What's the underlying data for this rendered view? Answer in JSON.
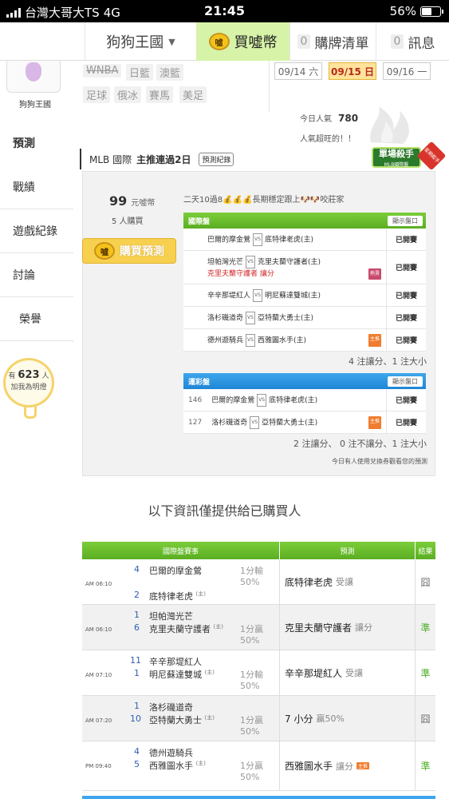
{
  "status_bar": {
    "carrier": "台灣大哥大TS",
    "network": "4G",
    "time": "21:45",
    "battery": "56%",
    "battery_level": 0.56
  },
  "nav": {
    "site_name": "狗狗王國",
    "buy_label": "買噓幣",
    "coin_glyph": "噓",
    "list_count": "0",
    "list_label": "購牌清單",
    "msg_count": "0",
    "msg_label": "訊息"
  },
  "profile": {
    "username": "狗狗王國"
  },
  "sidebar": {
    "items": [
      {
        "label": "預測"
      },
      {
        "label": "戰績"
      },
      {
        "label": "遊戲紀錄"
      },
      {
        "label": "討論"
      },
      {
        "label": "榮譽"
      }
    ]
  },
  "bulb": {
    "prefix": "有",
    "count": "623",
    "suffix": "人",
    "line2": "加我為明燈"
  },
  "sport_tags": [
    "WNBA",
    "日籃",
    "澳籃",
    "足球",
    "俄冰",
    "賽馬",
    "美足"
  ],
  "dates": [
    {
      "label": "09/14 六"
    },
    {
      "label": "09/15 日",
      "active": true
    },
    {
      "label": "09/16 一"
    }
  ],
  "popularity": {
    "label": "今日人氣",
    "value": "780",
    "note": "人氣超旺的！！"
  },
  "prediction": {
    "league": "MLB 國際",
    "streak": "主推連過2日",
    "record_btn": "預測紀錄",
    "badge_main": "單場殺手",
    "badge_sub": "MLB國際盤",
    "badge_corner": "星期殺手",
    "price": "99",
    "price_unit": "元噓幣",
    "buyers": "5 人購買",
    "buy_button": "購買預測",
    "lead_text": "二天10過8💰💰💰長期穩定跟上🐶🐶咬莊家",
    "intl_header": "國際盤",
    "show_btn": "顯示盤口",
    "intl_rows": [
      {
        "away": "巴爾的摩金鶯",
        "home": "底特律老虎(主)",
        "status": "已開賽"
      },
      {
        "away": "坦帕灣光芒",
        "home": "克里夫蘭守護者(主)",
        "pick": "克里夫蘭守護者",
        "pick_type": "讓分",
        "icon": "熱賣",
        "status": "已開賽"
      },
      {
        "away": "辛辛那堤紅人",
        "home": "明尼蘇達雙城(主)",
        "status": "已開賽"
      },
      {
        "away": "洛杉磯道奇",
        "home": "亞特蘭大勇士(主)",
        "status": "已開賽"
      },
      {
        "away": "德州遊騎兵",
        "home": "西雅圖水手(主)",
        "icon": "主推",
        "status": "已開賽"
      }
    ],
    "intl_summary": "4 注讓分、1 注大小",
    "lottery_header": "運彩盤",
    "lottery_rows": [
      {
        "no": "146",
        "away": "巴爾的摩金鶯",
        "home": "底特律老虎(主)",
        "status": "已開賽"
      },
      {
        "no": "127",
        "away": "洛杉磯道奇",
        "home": "亞特蘭大勇士(主)",
        "icon": "主推",
        "status": "已開賽"
      }
    ],
    "lottery_summary": "2 注讓分、 0 注不讓分、1 注大小",
    "note": "今日有人使用兌換券觀看您的預測"
  },
  "info_text": "以下資訊僅提供給已購買人",
  "table": {
    "headers": {
      "match": "國際盤賽事",
      "pred": "預測",
      "result": "結果"
    },
    "rows": [
      {
        "time": "AM 06:10",
        "n1": "4",
        "t1": "巴爾的摩金鶯",
        "n2": "2",
        "t2": "底特律老虎",
        "home_mark": "(主)",
        "hc1": "1分輸",
        "hc2": "50%",
        "pick": "底特律老虎",
        "pick_type": "受讓",
        "result": "囧",
        "res_class": "kun"
      },
      {
        "time": "AM 06:10",
        "n1": "1",
        "t1": "坦帕灣光芒",
        "n2": "6",
        "t2": "克里夫蘭守護者",
        "home_mark": "(主)",
        "hc1": "1分贏",
        "hc2": "50%",
        "pick": "克里夫蘭守護者",
        "pick_type": "讓分",
        "result": "準",
        "res_class": "jun"
      },
      {
        "time": "AM 07:10",
        "n1": "11",
        "t1": "辛辛那堤紅人",
        "n2": "1",
        "t2": "明尼蘇達雙城",
        "home_mark": "(主)",
        "hc1": "1分輸",
        "hc2": "50%",
        "pick": "辛辛那堤紅人",
        "pick_type": "受讓",
        "result": "準",
        "res_class": "jun"
      },
      {
        "time": "AM 07:20",
        "n1": "1",
        "t1": "洛杉磯道奇",
        "n2": "10",
        "t2": "亞特蘭大勇士",
        "home_mark": "(主)",
        "hc1": "1分贏",
        "hc2": "50%",
        "pick": "7 小分",
        "pick_type": "贏50%",
        "result": "囧",
        "res_class": "kun"
      },
      {
        "time": "PM 09:40",
        "n1": "4",
        "t1": "德州遊騎兵",
        "n2": "5",
        "t2": "西雅圖水手",
        "home_mark": "(主)",
        "hc1": "1分贏",
        "hc2": "50%",
        "pick": "西雅圖水手",
        "pick_type": "讓分",
        "pick_icon": "主推",
        "result": "準",
        "res_class": "jun"
      }
    ]
  },
  "colors": {
    "green": "#5aae21",
    "blue": "#1f86d6",
    "active_nav": "#d6f3a8",
    "red": "#d0282a"
  }
}
